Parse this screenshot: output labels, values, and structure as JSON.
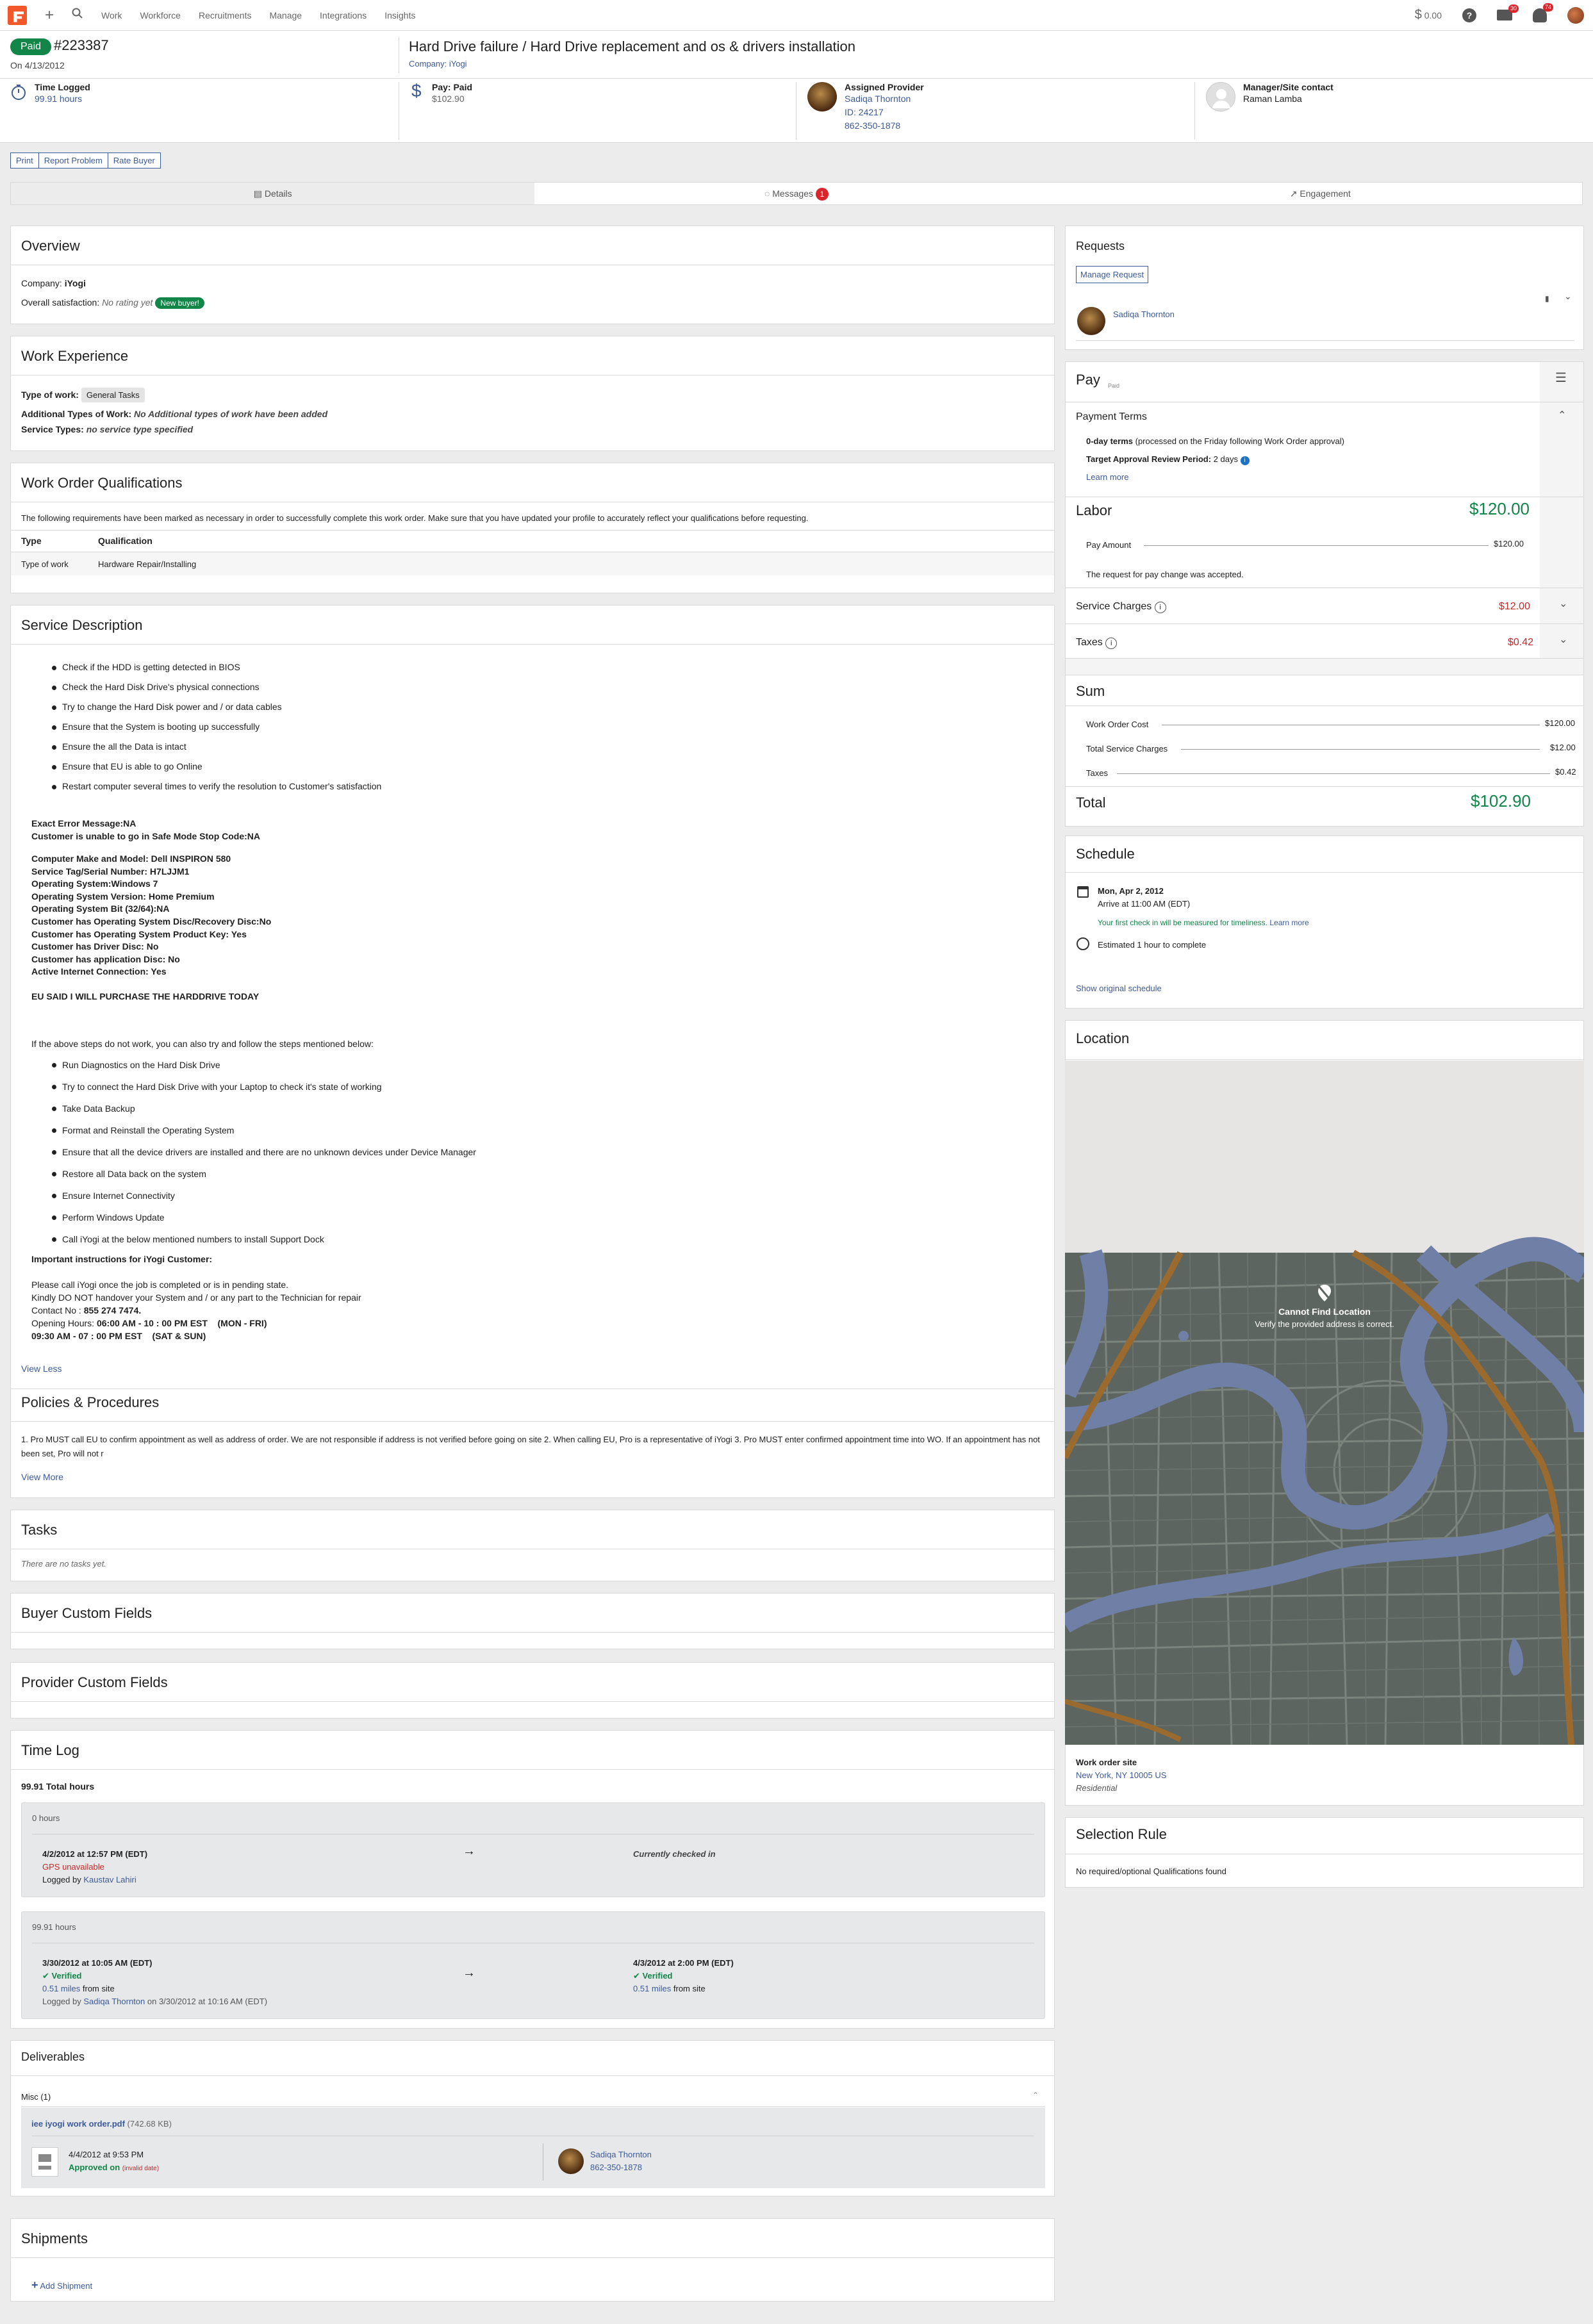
{
  "nav": {
    "links": [
      "Work",
      "Workforce",
      "Recruitments",
      "Manage",
      "Integrations",
      "Insights"
    ],
    "balance": "0.00",
    "help": "?",
    "mail_badge": "30",
    "bell_badge": "74",
    "plus_icon": "+",
    "search_icon": "search-icon"
  },
  "header": {
    "status": "Paid",
    "number": "#223387",
    "date": "On 4/13/2012",
    "title": "Hard Drive failure / Hard Drive replacement and os & drivers installation",
    "company": "Company: iYogi",
    "time_label": "Time Logged",
    "time_value": "99.91 hours",
    "pay_label": "Pay: Paid",
    "pay_value": "$102.90",
    "provider_label": "Assigned Provider",
    "provider_name": "Sadiqa Thornton",
    "provider_id": "ID: 24217",
    "provider_phone": "862-350-1878",
    "manager_label": "Manager/Site contact",
    "manager_name": "Raman Lamba"
  },
  "actions": [
    "Print",
    "Report Problem",
    "Rate Buyer"
  ],
  "tabs": {
    "details": "Details",
    "messages": "Messages",
    "messages_badge": "1",
    "engagement": "Engagement"
  },
  "overview": {
    "title": "Overview",
    "company_label": "Company:",
    "company": "iYogi",
    "sat_label": "Overall satisfaction:",
    "sat_value": "No rating yet",
    "new_buyer": "New buyer!"
  },
  "work_experience": {
    "title": "Work Experience",
    "type_label": "Type of work:",
    "type_value": "General Tasks",
    "additional_label": "Additional Types of Work:",
    "additional_value": "No Additional types of work have been added",
    "service_label": "Service Types:",
    "service_value": "no service type specified"
  },
  "qualifications": {
    "title": "Work Order Qualifications",
    "intro": "The following requirements have been marked as necessary in order to successfully complete this work order. Make sure that you have updated your profile to accurately reflect your qualifications before requesting.",
    "col_type": "Type",
    "col_qual": "Qualification",
    "row_type": "Type of work",
    "row_qual": "Hardware Repair/Installing"
  },
  "service": {
    "title": "Service Description",
    "steps1": [
      "Check if the HDD is getting detected in BIOS",
      "Check the Hard Disk Drive's physical connections",
      "Try to change the Hard Disk power and / or data cables",
      "Ensure that the System is booting up successfully",
      "Ensure the all the Data is intact",
      "Ensure that EU is able to go Online",
      "Restart computer several times to verify the resolution to Customer's satisfaction"
    ],
    "err1": "Exact Error Message:NA",
    "err2": "Customer is unable to go in Safe Mode Stop Code:NA",
    "specs": [
      "Computer Make and Model: Dell INSPIRON 580",
      "Service Tag/Serial Number: H7LJJM1",
      "Operating System:Windows 7",
      "Operating System Version: Home Premium",
      "Operating System Bit (32/64):NA",
      "Customer has Operating System Disc/Recovery Disc:No",
      "Customer has Operating System Product Key: Yes",
      "Customer has Driver Disc: No",
      "Customer has application Disc: No",
      "Active Internet Connection: Yes"
    ],
    "eu_said": "EU SAID I WILL PURCHASE THE HARDDRIVE TODAY",
    "if_text": "If the above steps do not work, you can also try and follow the steps mentioned below:",
    "steps2": [
      "Run Diagnostics on the Hard Disk Drive",
      "Try to connect the Hard Disk Drive with your Laptop to check it's state of working",
      "Take Data Backup",
      "Format and Reinstall the Operating System",
      "Ensure that all the device drivers are installed and there are no unknown devices under Device Manager",
      "Restore all Data back on the system",
      "Ensure Internet Connectivity",
      "Perform Windows Update",
      "Call iYogi at the below mentioned numbers to install Support Dock"
    ],
    "important": "Important instructions for iYogi Customer:",
    "line1": "Please call iYogi once the job is completed or is in pending state.",
    "line2": "Kindly DO NOT handover your System and / or any part to the Technician for repair",
    "contact_label": "Contact No :",
    "contact": "855 274 7474.",
    "hours_label": "Opening Hours:",
    "hours1": "06:00 AM - 10 : 00 PM EST    (MON - FRI)",
    "hours2": "09:30 AM - 07 : 00 PM EST    (SAT & SUN)",
    "view_less": "View Less"
  },
  "policies": {
    "title": "Policies & Procedures",
    "text": "1. Pro MUST call EU to confirm appointment as well as address of order. We are not responsible if address is not verified before going on site 2. When calling EU, Pro is a representative of iYogi 3. Pro MUST enter confirmed appointment time into WO. If an appointment has not been set, Pro will not r",
    "view_more": "View More"
  },
  "tasks": {
    "title": "Tasks",
    "empty": "There are no tasks yet."
  },
  "buyer_fields": {
    "title": "Buyer Custom Fields"
  },
  "provider_fields": {
    "title": "Provider Custom Fields"
  },
  "timelog": {
    "title": "Time Log",
    "total": "99.91 Total hours",
    "entry1": {
      "hours": "0 hours",
      "start": "4/2/2012 at 12:57 PM (EDT)",
      "gps": "GPS unavailable",
      "logged_by": "Logged by",
      "logger": "Kaustav Lahiri",
      "end": "Currently checked in"
    },
    "entry2": {
      "hours": "99.91 hours",
      "start": "3/30/2012 at 10:05 AM (EDT)",
      "verified": "Verified",
      "distance1": "0.51 miles",
      "from_site": "from site",
      "logged_by": "Logged by",
      "logger": "Sadiqa Thornton",
      "logged_on": "on 3/30/2012 at 10:16 AM (EDT)",
      "end": "4/3/2012 at 2:00 PM (EDT)",
      "end_verified": "Verified",
      "distance2": "0.51 miles",
      "from_site2": "from site"
    }
  },
  "deliverables": {
    "title": "Deliverables",
    "misc": "Misc (1)",
    "file": "iee iyogi work order.pdf",
    "size": "(742.68 KB)",
    "uploaded": "4/4/2012 at 9:53 PM",
    "approved": "Approved on",
    "invalid": "(invalid date)",
    "user": "Sadiqa Thornton",
    "phone": "862-350-1878"
  },
  "shipments": {
    "title": "Shipments",
    "add": "Add Shipment"
  },
  "requests": {
    "title": "Requests",
    "manage": "Manage Request",
    "requester": "Sadiqa Thornton"
  },
  "pay": {
    "title": "Pay",
    "status": "Paid",
    "terms_title": "Payment Terms",
    "terms_bold": "0-day terms",
    "terms_rest": "(processed on the Friday following Work Order approval)",
    "target_label": "Target Approval Review Period:",
    "target_value": "2 days",
    "learn_more": "Learn more",
    "labor_title": "Labor",
    "labor_total": "$120.00",
    "pay_amount_label": "Pay Amount",
    "pay_amount": "$120.00",
    "accepted": "The request for pay change was accepted.",
    "service_charges": "Service Charges",
    "service_amount": "$12.00",
    "taxes": "Taxes",
    "taxes_amount": "$0.42",
    "sum_title": "Sum",
    "wo_cost_label": "Work Order Cost",
    "wo_cost": "$120.00",
    "tsc_label": "Total Service Charges",
    "tsc": "$12.00",
    "taxes_label": "Taxes",
    "taxes_val": "$0.42",
    "total_label": "Total",
    "total": "$102.90",
    "accent": "#128548",
    "negative": "#c62828"
  },
  "schedule": {
    "title": "Schedule",
    "date": "Mon, Apr 2, 2012",
    "arrive": "Arrive at 11:00 AM (EDT)",
    "note": "Your first check in will be measured for timeliness.",
    "learn_more": "Learn more",
    "estimate": "Estimated 1 hour to complete",
    "show_original": "Show original schedule"
  },
  "location": {
    "title": "Location",
    "cannot_find": "Cannot Find Location",
    "verify": "Verify the provided address is correct.",
    "site_label": "Work order site",
    "address": "New York, NY 10005 US",
    "type": "Residential"
  },
  "selection": {
    "title": "Selection Rule",
    "text": "No required/optional Qualifications found"
  }
}
